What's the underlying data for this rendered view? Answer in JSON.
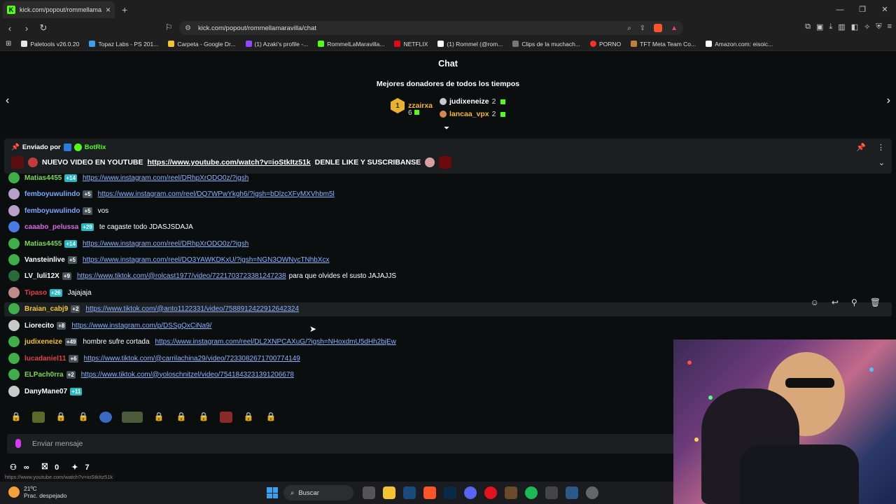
{
  "browser": {
    "tab_title": "kick.com/popout/rommellamara",
    "tab_favicon": "K",
    "url": "kick.com/popout/rommellamaravilla/chat",
    "bookmarks": [
      {
        "label": "Paletools v26.0.20",
        "color": "#e6e6e6"
      },
      {
        "label": "Topaz Labs - PS 201...",
        "color": "#3aa0f0"
      },
      {
        "label": "Carpeta - Google Dr...",
        "color": "#f2c230"
      },
      {
        "label": "(1) Azaki's profile -...",
        "color": "#9146ff"
      },
      {
        "label": "RommelLaMaravilla...",
        "color": "#53fc18"
      },
      {
        "label": "NETFLIX",
        "color": "#e50914"
      },
      {
        "label": "(1) Rommel (@rom...",
        "color": "#ffffff"
      },
      {
        "label": "Clips de la muchach...",
        "color": "#777777"
      },
      {
        "label": "PORNO",
        "color": "#ff2d2d"
      },
      {
        "label": "TFT Meta Team Co...",
        "color": "#c0823a"
      },
      {
        "label": "Amazon.com: eisoic...",
        "color": "#ffffff"
      }
    ]
  },
  "chat": {
    "title": "Chat",
    "donors_title": "Mejores donadores de todos los tiempos",
    "top_donor": {
      "rank": "1",
      "name": "zzairxa",
      "count": "6"
    },
    "second_donor": {
      "name": "judixeneize",
      "count": "2"
    },
    "third_donor": {
      "name": "lancaa_vpx",
      "count": "2"
    }
  },
  "pinned": {
    "sent_by_label": "Enviado por",
    "sender": "BotRix",
    "text_before": "NUEVO VIDEO EN YOUTUBE",
    "link": "https://www.youtube.com/watch?v=ioStkItz51k",
    "text_after": "DENLE LIKE Y SUSCRIBANSE"
  },
  "messages": [
    {
      "user": "Matias4455",
      "color": "#7fd45a",
      "avatar": "#3fae4a",
      "badge": "+14",
      "badge_sub": true,
      "link": "https://www.instagram.com/reel/DRhpXrODO0z/?igsh",
      "text": ""
    },
    {
      "user": "femboyuwulindo",
      "color": "#7ea7ff",
      "avatar": "#b9a0c9",
      "badge": "+5",
      "badge_sub": false,
      "link": "https://www.instagram.com/reel/DQ7WPwYkgh6/?igsh=bDlzcXFyMXVhbm5l",
      "text": ""
    },
    {
      "user": "femboyuwulindo",
      "color": "#7ea7ff",
      "avatar": "#b9a0c9",
      "badge": "+5",
      "badge_sub": false,
      "link": "",
      "text": "vos"
    },
    {
      "user": "caaabo_pelussa",
      "color": "#d46be0",
      "avatar": "#4a7be0",
      "badge": "+29",
      "badge_sub": true,
      "link": "",
      "text": "te cagaste todo JDASJSDAJA"
    },
    {
      "user": "Matias4455",
      "color": "#7fd45a",
      "avatar": "#3fae4a",
      "badge": "+14",
      "badge_sub": true,
      "link": "https://www.instagram.com/reel/DRhpXrODO0z/?igsh",
      "text": ""
    },
    {
      "user": "Vansteinlive",
      "color": "#ffffff",
      "avatar": "#3fae4a",
      "badge": "+5",
      "badge_sub": false,
      "link": "https://www.instagram.com/reel/DO3YAWKDKxU/?igsh=NGN3OWNycTNhbXcx",
      "text": ""
    },
    {
      "user": "LV_luli12X",
      "color": "#ffffff",
      "avatar": "#2a6a3a",
      "badge": "+9",
      "badge_sub": false,
      "link": "https://www.tiktok.com/@rolcast1977/video/7221703723381247238",
      "text": "para que olvides el susto JAJAJJS"
    },
    {
      "user": "Tipaso",
      "color": "#e0414a",
      "avatar": "#c08a8a",
      "badge": "+26",
      "badge_sub": true,
      "link": "",
      "text": "Jajajaja"
    },
    {
      "user": "Braian_cabj9",
      "color": "#f2c230",
      "avatar": "#3fae4a",
      "badge": "+2",
      "badge_sub": false,
      "link": "https://www.tiktok.com/@anto1122331/video/7588912422912642324",
      "text": ""
    },
    {
      "user": "Liorecito",
      "color": "#ffffff",
      "avatar": "#c9c9c9",
      "badge": "+8",
      "badge_sub": false,
      "link": "https://www.instagram.com/p/DSSgQxCiNa9/",
      "text": ""
    },
    {
      "user": "judixeneize",
      "color": "#f2c230",
      "avatar": "#3fae4a",
      "badge": "+49",
      "badge_sub": false,
      "link": "https://www.instagram.com/reel/DL2XNPCAXuG/?igsh=NHoxdmU5dHh2bjEw",
      "text": "hombre sufre cortada"
    },
    {
      "user": "lucadaniel11",
      "color": "#e0414a",
      "avatar": "#3fae4a",
      "badge": "+6",
      "badge_sub": false,
      "link": "https://www.tiktok.com/@carrilachina29/video/7233082671700774149",
      "text": ""
    },
    {
      "user": "ELPach0rra",
      "color": "#7fd45a",
      "avatar": "#3fae4a",
      "badge": "+2",
      "badge_sub": false,
      "link": "https://www.tiktok.com/@yoloschnitzel/video/7541843231391206678",
      "text": ""
    },
    {
      "user": "DanyMane07",
      "color": "#ffffff",
      "avatar": "#c9c9c9",
      "badge": "+11",
      "badge_sub": true,
      "link": "",
      "text": ""
    }
  ],
  "input": {
    "placeholder": "Enviar mensaje"
  },
  "bottom_stats": {
    "infinity": "∞",
    "gifts": "0",
    "points": "7"
  },
  "status_url": "https://www.youtube.com/watch?v=ioStkItz51k",
  "taskbar": {
    "temp": "21ºC",
    "weather": "Prac. despejado",
    "search": "Buscar"
  }
}
